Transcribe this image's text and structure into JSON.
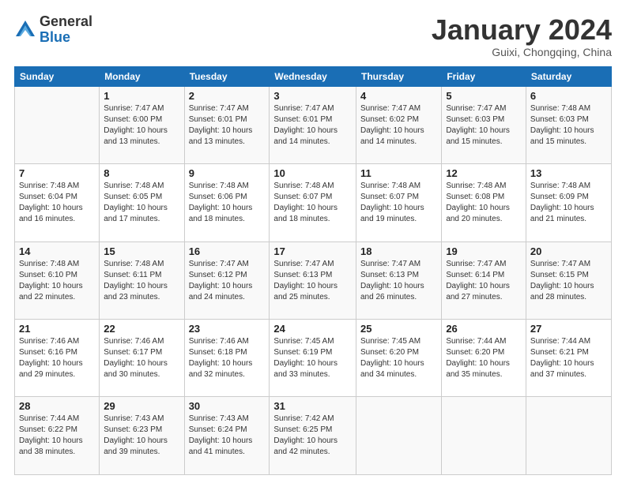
{
  "header": {
    "logo_general": "General",
    "logo_blue": "Blue",
    "month_title": "January 2024",
    "location": "Guixi, Chongqing, China"
  },
  "days_of_week": [
    "Sunday",
    "Monday",
    "Tuesday",
    "Wednesday",
    "Thursday",
    "Friday",
    "Saturday"
  ],
  "weeks": [
    [
      {
        "day": "",
        "info": ""
      },
      {
        "day": "1",
        "info": "Sunrise: 7:47 AM\nSunset: 6:00 PM\nDaylight: 10 hours and 13 minutes."
      },
      {
        "day": "2",
        "info": "Sunrise: 7:47 AM\nSunset: 6:01 PM\nDaylight: 10 hours and 13 minutes."
      },
      {
        "day": "3",
        "info": "Sunrise: 7:47 AM\nSunset: 6:01 PM\nDaylight: 10 hours and 14 minutes."
      },
      {
        "day": "4",
        "info": "Sunrise: 7:47 AM\nSunset: 6:02 PM\nDaylight: 10 hours and 14 minutes."
      },
      {
        "day": "5",
        "info": "Sunrise: 7:47 AM\nSunset: 6:03 PM\nDaylight: 10 hours and 15 minutes."
      },
      {
        "day": "6",
        "info": "Sunrise: 7:48 AM\nSunset: 6:03 PM\nDaylight: 10 hours and 15 minutes."
      }
    ],
    [
      {
        "day": "7",
        "info": "Sunrise: 7:48 AM\nSunset: 6:04 PM\nDaylight: 10 hours and 16 minutes."
      },
      {
        "day": "8",
        "info": "Sunrise: 7:48 AM\nSunset: 6:05 PM\nDaylight: 10 hours and 17 minutes."
      },
      {
        "day": "9",
        "info": "Sunrise: 7:48 AM\nSunset: 6:06 PM\nDaylight: 10 hours and 18 minutes."
      },
      {
        "day": "10",
        "info": "Sunrise: 7:48 AM\nSunset: 6:07 PM\nDaylight: 10 hours and 18 minutes."
      },
      {
        "day": "11",
        "info": "Sunrise: 7:48 AM\nSunset: 6:07 PM\nDaylight: 10 hours and 19 minutes."
      },
      {
        "day": "12",
        "info": "Sunrise: 7:48 AM\nSunset: 6:08 PM\nDaylight: 10 hours and 20 minutes."
      },
      {
        "day": "13",
        "info": "Sunrise: 7:48 AM\nSunset: 6:09 PM\nDaylight: 10 hours and 21 minutes."
      }
    ],
    [
      {
        "day": "14",
        "info": "Sunrise: 7:48 AM\nSunset: 6:10 PM\nDaylight: 10 hours and 22 minutes."
      },
      {
        "day": "15",
        "info": "Sunrise: 7:48 AM\nSunset: 6:11 PM\nDaylight: 10 hours and 23 minutes."
      },
      {
        "day": "16",
        "info": "Sunrise: 7:47 AM\nSunset: 6:12 PM\nDaylight: 10 hours and 24 minutes."
      },
      {
        "day": "17",
        "info": "Sunrise: 7:47 AM\nSunset: 6:13 PM\nDaylight: 10 hours and 25 minutes."
      },
      {
        "day": "18",
        "info": "Sunrise: 7:47 AM\nSunset: 6:13 PM\nDaylight: 10 hours and 26 minutes."
      },
      {
        "day": "19",
        "info": "Sunrise: 7:47 AM\nSunset: 6:14 PM\nDaylight: 10 hours and 27 minutes."
      },
      {
        "day": "20",
        "info": "Sunrise: 7:47 AM\nSunset: 6:15 PM\nDaylight: 10 hours and 28 minutes."
      }
    ],
    [
      {
        "day": "21",
        "info": "Sunrise: 7:46 AM\nSunset: 6:16 PM\nDaylight: 10 hours and 29 minutes."
      },
      {
        "day": "22",
        "info": "Sunrise: 7:46 AM\nSunset: 6:17 PM\nDaylight: 10 hours and 30 minutes."
      },
      {
        "day": "23",
        "info": "Sunrise: 7:46 AM\nSunset: 6:18 PM\nDaylight: 10 hours and 32 minutes."
      },
      {
        "day": "24",
        "info": "Sunrise: 7:45 AM\nSunset: 6:19 PM\nDaylight: 10 hours and 33 minutes."
      },
      {
        "day": "25",
        "info": "Sunrise: 7:45 AM\nSunset: 6:20 PM\nDaylight: 10 hours and 34 minutes."
      },
      {
        "day": "26",
        "info": "Sunrise: 7:44 AM\nSunset: 6:20 PM\nDaylight: 10 hours and 35 minutes."
      },
      {
        "day": "27",
        "info": "Sunrise: 7:44 AM\nSunset: 6:21 PM\nDaylight: 10 hours and 37 minutes."
      }
    ],
    [
      {
        "day": "28",
        "info": "Sunrise: 7:44 AM\nSunset: 6:22 PM\nDaylight: 10 hours and 38 minutes."
      },
      {
        "day": "29",
        "info": "Sunrise: 7:43 AM\nSunset: 6:23 PM\nDaylight: 10 hours and 39 minutes."
      },
      {
        "day": "30",
        "info": "Sunrise: 7:43 AM\nSunset: 6:24 PM\nDaylight: 10 hours and 41 minutes."
      },
      {
        "day": "31",
        "info": "Sunrise: 7:42 AM\nSunset: 6:25 PM\nDaylight: 10 hours and 42 minutes."
      },
      {
        "day": "",
        "info": ""
      },
      {
        "day": "",
        "info": ""
      },
      {
        "day": "",
        "info": ""
      }
    ]
  ]
}
